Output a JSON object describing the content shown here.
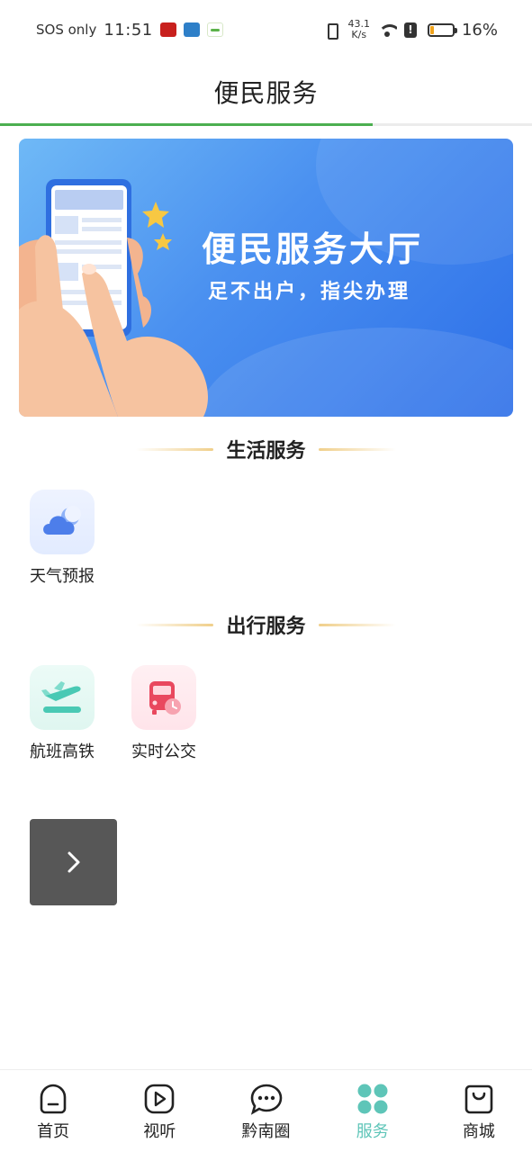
{
  "status_bar": {
    "sos": "SOS only",
    "time": "11:51",
    "speed_value": "43.1",
    "speed_unit": "K/s",
    "battery_percent": "16%",
    "battery_level": 0.16
  },
  "header": {
    "title": "便民服务",
    "progress": 0.7,
    "accent_color": "#4caf50"
  },
  "banner": {
    "title": "便民服务大厅",
    "subtitle": "足不出户，指尖办理"
  },
  "sections": [
    {
      "title": "生活服务",
      "items": [
        {
          "label": "天气预报",
          "icon": "weather-icon"
        }
      ]
    },
    {
      "title": "出行服务",
      "items": [
        {
          "label": "航班高铁",
          "icon": "flight-icon"
        },
        {
          "label": "实时公交",
          "icon": "bus-icon"
        }
      ]
    }
  ],
  "next_button": {
    "icon": "chevron-right-icon"
  },
  "bottom_nav": {
    "active_color": "#5ec5b8",
    "items": [
      {
        "label": "首页",
        "icon": "home-icon"
      },
      {
        "label": "视听",
        "icon": "play-icon"
      },
      {
        "label": "黔南圈",
        "icon": "chat-icon"
      },
      {
        "label": "服务",
        "icon": "grid-icon",
        "active": true
      },
      {
        "label": "商城",
        "icon": "shopping-bag-icon"
      }
    ]
  }
}
